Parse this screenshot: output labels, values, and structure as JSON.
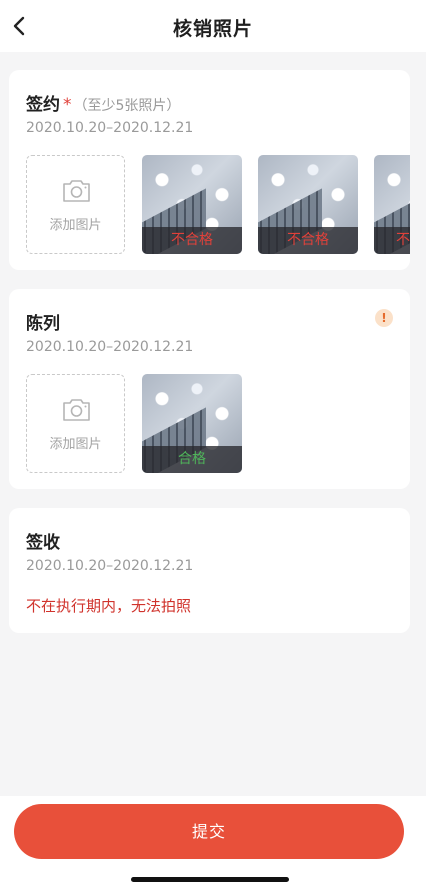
{
  "navbar": {
    "title": "核销照片",
    "back_icon": "chevron-left-icon"
  },
  "sections": {
    "sign": {
      "title": "签约",
      "required_mark": "*",
      "hint": "（至少5张照片）",
      "date_range": "2020.10.20–2020.12.21",
      "add_label": "添加图片",
      "photos": [
        {
          "status": "不合格",
          "color": "#e0413a"
        },
        {
          "status": "不合格",
          "color": "#e0413a"
        },
        {
          "status": "不",
          "color": "#e0413a"
        }
      ]
    },
    "display": {
      "title": "陈列",
      "warn_icon": "!",
      "date_range": "2020.10.20–2020.12.21",
      "add_label": "添加图片",
      "photos": [
        {
          "status": "合格",
          "color": "#4fb35a"
        }
      ]
    },
    "receipt": {
      "title": "签收",
      "date_range": "2020.10.20–2020.12.21",
      "message": "不在执行期内，无法拍照"
    }
  },
  "footer": {
    "submit_label": "提交",
    "accent": "#e8503a"
  }
}
